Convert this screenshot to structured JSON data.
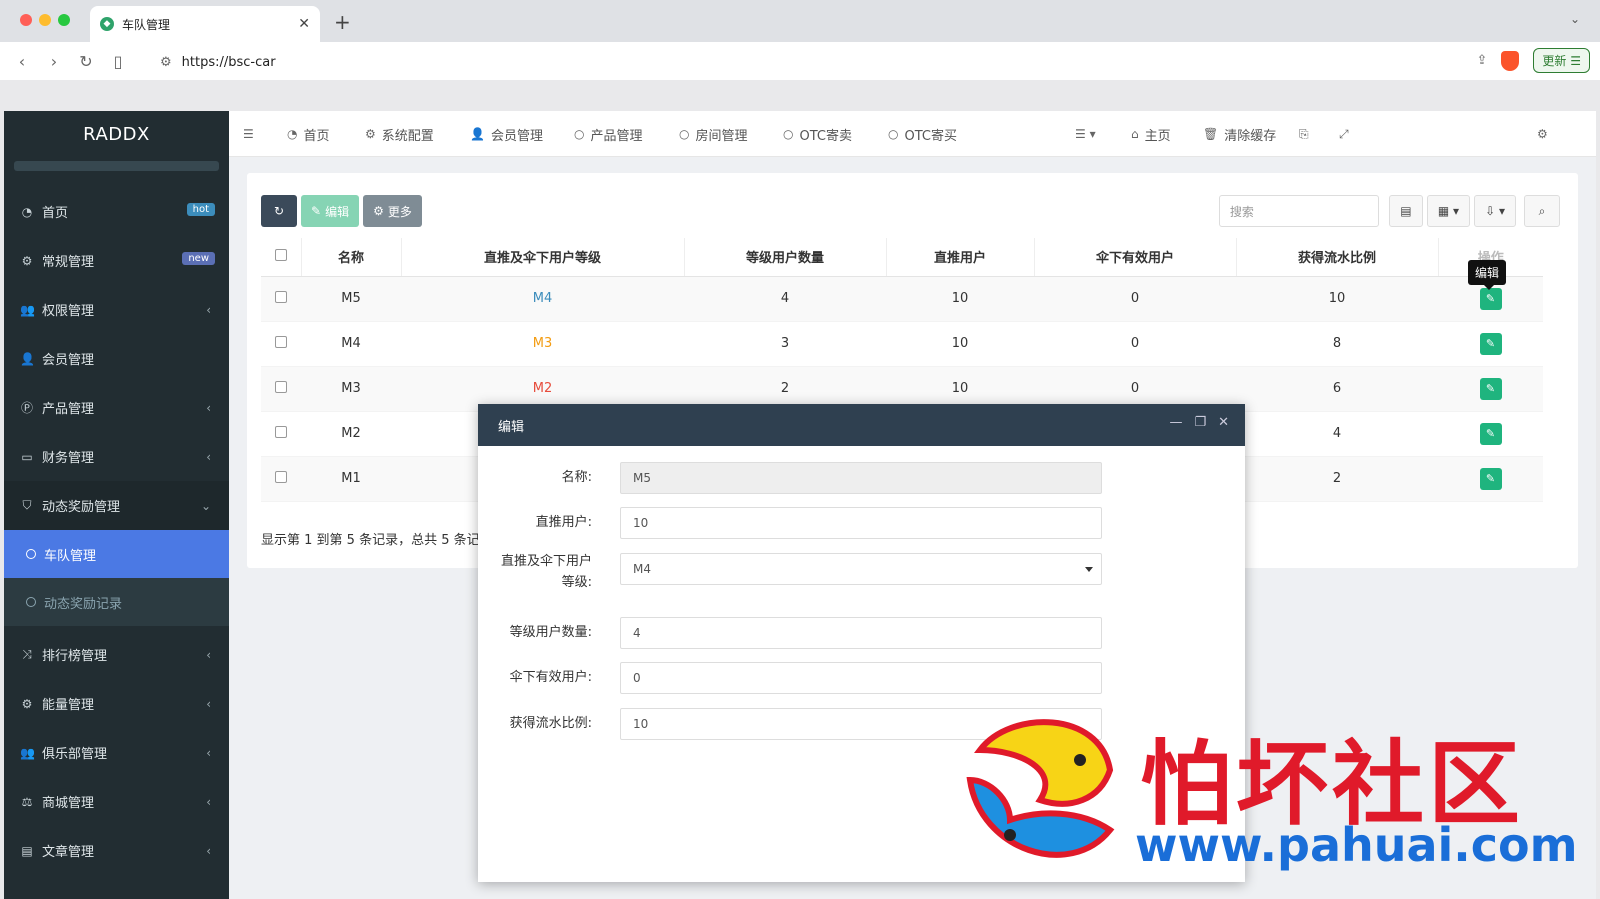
{
  "browser": {
    "tab_title": "车队管理",
    "url": "https://bsc-car",
    "update_label": "更新"
  },
  "sidebar": {
    "brand": "RADDX",
    "items": [
      {
        "label": "首页",
        "icon": "dashboard-icon",
        "badge": "hot",
        "badge_color": "#3c8dbc"
      },
      {
        "label": "常规管理",
        "icon": "cogs-icon",
        "badge": "new",
        "badge_color": "#5b6fb5"
      },
      {
        "label": "权限管理",
        "icon": "users-icon",
        "chevron": "‹"
      },
      {
        "label": "会员管理",
        "icon": "user-icon"
      },
      {
        "label": "产品管理",
        "icon": "product-icon",
        "chevron": "‹"
      },
      {
        "label": "财务管理",
        "icon": "card-icon",
        "chevron": "‹"
      },
      {
        "label": "动态奖励管理",
        "icon": "shield-icon",
        "chevron": "⌄"
      }
    ],
    "sub_items": [
      {
        "label": "车队管理",
        "active": true
      },
      {
        "label": "动态奖励记录",
        "active": false
      }
    ],
    "items_after": [
      {
        "label": "排行榜管理",
        "icon": "random-icon"
      },
      {
        "label": "能量管理",
        "icon": "gear-icon"
      },
      {
        "label": "俱乐部管理",
        "icon": "users-icon"
      },
      {
        "label": "商城管理",
        "icon": "scale-icon"
      },
      {
        "label": "文章管理",
        "icon": "newspaper-icon"
      }
    ]
  },
  "topnav": {
    "items": [
      "首页",
      "系统配置",
      "会员管理",
      "产品管理",
      "房间管理",
      "OTC寄卖",
      "OTC寄买"
    ],
    "right": [
      "主页",
      "清除缓存"
    ]
  },
  "toolbar": {
    "edit_label": "编辑",
    "more_label": "更多",
    "search_placeholder": "搜索"
  },
  "table": {
    "headers": [
      "名称",
      "直推及伞下用户等级",
      "等级用户数量",
      "直推用户",
      "伞下有效用户",
      "获得流水比例",
      "操作"
    ],
    "rows": [
      {
        "name": "M5",
        "level": "M4",
        "level_color": "#3c8dbc",
        "count": "4",
        "direct": "10",
        "umbrella": "0",
        "ratio": "10"
      },
      {
        "name": "M4",
        "level": "M3",
        "level_color": "#f39c12",
        "count": "3",
        "direct": "10",
        "umbrella": "0",
        "ratio": "8"
      },
      {
        "name": "M3",
        "level": "M2",
        "level_color": "#e74c3c",
        "count": "2",
        "direct": "10",
        "umbrella": "0",
        "ratio": "6"
      },
      {
        "name": "M2",
        "level": "",
        "level_color": "#333333",
        "count": "",
        "direct": "",
        "umbrella": "",
        "ratio": "4"
      },
      {
        "name": "M1",
        "level": "",
        "level_color": "#333333",
        "count": "",
        "direct": "",
        "umbrella": "",
        "ratio": "2"
      }
    ],
    "tooltip": "编辑",
    "page_info": "显示第 1 到第 5 条记录，总共 5 条记录"
  },
  "modal": {
    "title": "编辑",
    "fields": [
      {
        "label": "名称:",
        "value": "M5"
      },
      {
        "label": "直推用户:",
        "value": "10"
      },
      {
        "label": "直推及伞下用户",
        "label2": "等级:",
        "value": "M4"
      },
      {
        "label": "等级用户数量:",
        "value": "4"
      },
      {
        "label": "伞下有效用户:",
        "value": "0"
      },
      {
        "label": "获得流水比例:",
        "value": "10"
      }
    ]
  },
  "watermark": {
    "text": "怕坏社区",
    "url": "www.pahuai.com"
  }
}
